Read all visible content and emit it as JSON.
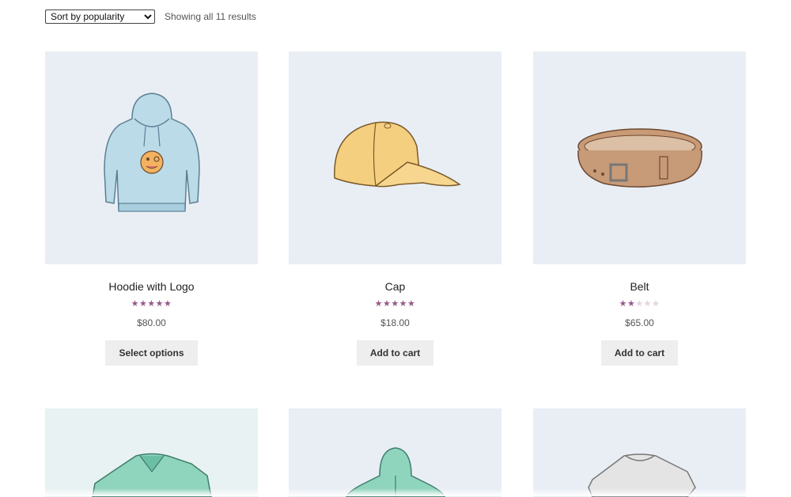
{
  "toolbar": {
    "sort_selected": "Sort by popularity",
    "result_count": "Showing all 11 results"
  },
  "colors": {
    "accent": "#96588a",
    "image_bg": "#e9eef5",
    "button_bg": "#eeeeee"
  },
  "products": [
    {
      "title": "Hoodie with Logo",
      "rating": 5,
      "price": "$80.00",
      "action": "Select options",
      "icon": "hoodie-with-logo-image"
    },
    {
      "title": "Cap",
      "rating": 5,
      "price": "$18.00",
      "action": "Add to cart",
      "icon": "cap-image"
    },
    {
      "title": "Belt",
      "rating": 2,
      "price": "$65.00",
      "action": "Add to cart",
      "icon": "belt-image"
    }
  ],
  "partial_products": [
    {
      "icon": "vneck-tshirt-image"
    },
    {
      "icon": "hoodie-with-zipper-image"
    },
    {
      "icon": "tshirt-image"
    }
  ]
}
